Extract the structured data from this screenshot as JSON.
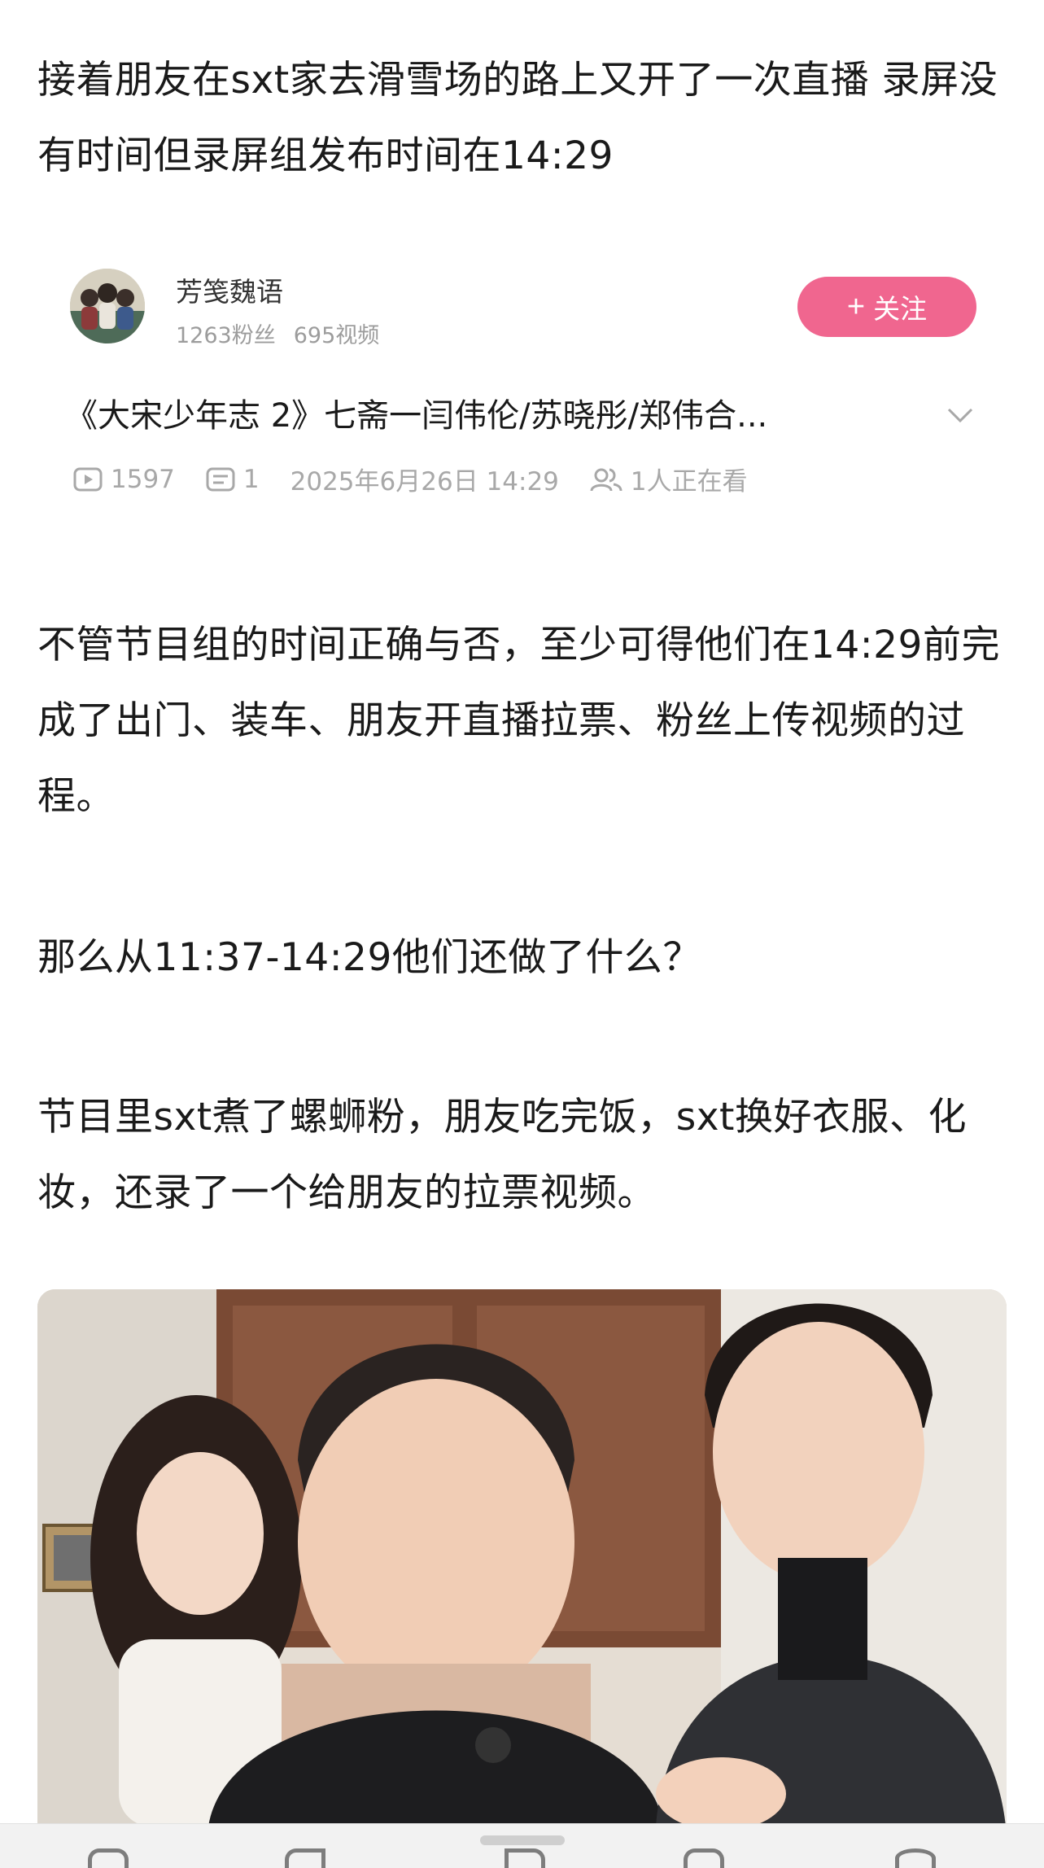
{
  "post": {
    "paragraph_1": "接着朋友在sxt家去滑雪场的路上又开了一次直播 录屏没有时间但录屏组发布时间在14:29",
    "paragraph_2": "不管节目组的时间正确与否，至少可得他们在14:29前完成了出门、装车、朋友开直播拉票、粉丝上传视频的过程。",
    "paragraph_3": "那么从11:37-14:29他们还做了什么？",
    "paragraph_4": "节目里sxt煮了螺蛳粉，朋友吃完饭，sxt换好衣服、化妆，还录了一个给朋友的拉票视频。"
  },
  "video_card": {
    "channel_name": "芳笺魏语",
    "fans": "1263粉丝",
    "videos": "695视频",
    "follow_label": "关注",
    "title": "《大宋少年志 2》七斋一闫伟伦/苏晓彤/郑伟合...",
    "play_count": "1597",
    "comment_count": "1",
    "publish_time": "2025年6月26日 14:29",
    "watching": "1人正在看"
  },
  "colors": {
    "follow_button": "#f0668f",
    "meta_text": "#a8a8a8",
    "body_text": "#1a1a1a"
  }
}
